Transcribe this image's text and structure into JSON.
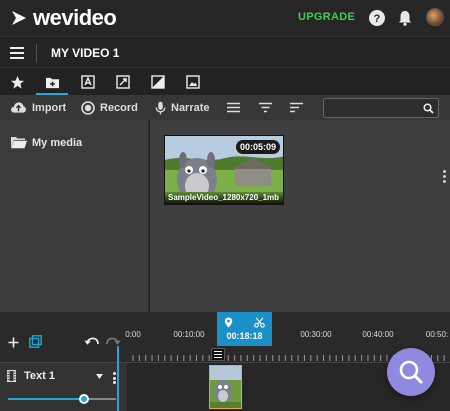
{
  "topbar": {
    "logo_text": "wevideo",
    "upgrade_label": "UPGRADE",
    "icons": [
      "help-icon",
      "bell-icon",
      "avatar"
    ]
  },
  "titlebar": {
    "project_name": "MY VIDEO 1"
  },
  "tabs": [
    "star-icon",
    "folder-plus-icon",
    "text-icon",
    "transitions-icon",
    "backgrounds-icon",
    "images-icon"
  ],
  "toolbar": {
    "import_label": "Import",
    "record_label": "Record",
    "narrate_label": "Narrate",
    "search_placeholder": ""
  },
  "media": {
    "folder_label": "My media",
    "items": [
      {
        "name": "SampleVideo_1280x720_1mb",
        "duration": "00:05:09"
      }
    ]
  },
  "timeline": {
    "ticks": [
      "0:00",
      "00:10:00",
      "00:20:00",
      "00:30:00",
      "00:40:00",
      "00:50:"
    ],
    "playhead_time": "00:18:18",
    "track_name": "Text 1",
    "volume": 0.7
  },
  "colors": {
    "accent": "#1ea7d8",
    "upgrade": "#3ccf4e",
    "fab": "#8f8ae0",
    "clip_border": "#f0a43c"
  }
}
